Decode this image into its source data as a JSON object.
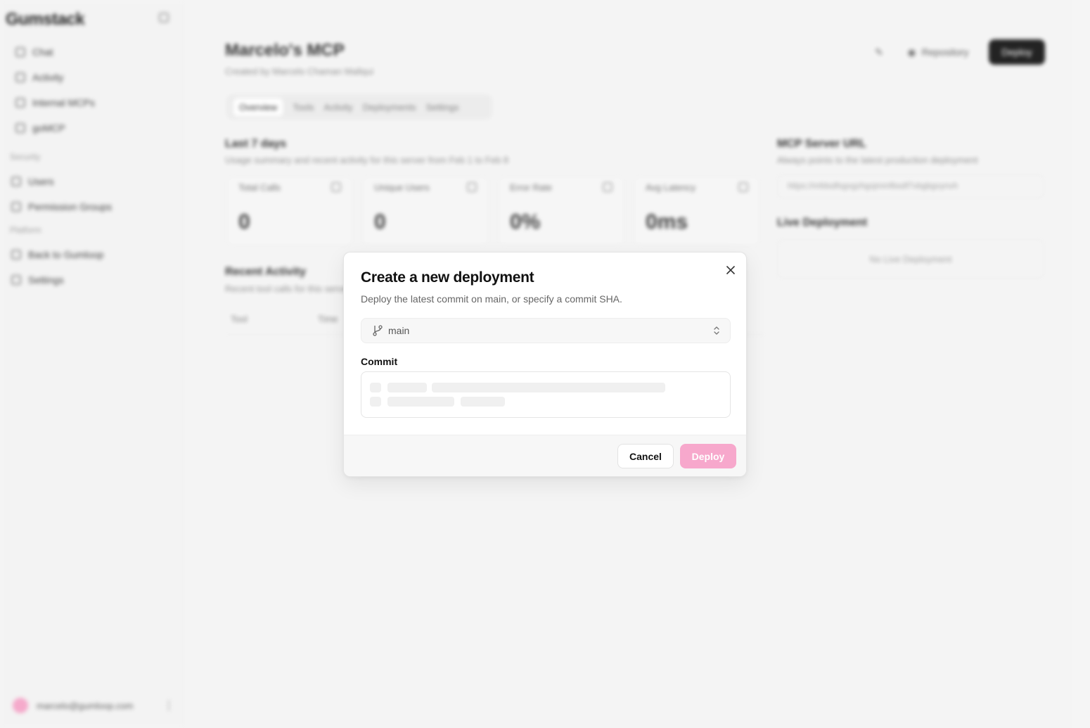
{
  "sidebar": {
    "logo": "Gumstack",
    "nav_items": [
      {
        "label": "Chat"
      },
      {
        "label": "Activity"
      },
      {
        "label": "Internal MCPs"
      },
      {
        "label": "goMCP"
      }
    ],
    "security_header": "Security",
    "security_items": [
      {
        "label": "Users"
      },
      {
        "label": "Permission Groups"
      }
    ],
    "platform_header": "Platform",
    "platform_items": [
      {
        "label": "Back to Gumloop"
      },
      {
        "label": "Settings"
      }
    ],
    "user_email": "marcelo@gumloop.com"
  },
  "header": {
    "title": "Marcelo's MCP",
    "subtitle": "Created by Marcelo Chaman Mallqui",
    "repo_label": "Repository",
    "deploy_label": "Deploy"
  },
  "tabs": [
    {
      "label": "Overview",
      "active": true
    },
    {
      "label": "Tools"
    },
    {
      "label": "Activity"
    },
    {
      "label": "Deployments"
    },
    {
      "label": "Settings"
    }
  ],
  "stats_section": {
    "title": "Last 7 days",
    "desc": "Usage summary and recent activity for this server from Feb 1 to Feb 8",
    "cards": [
      {
        "label": "Total Calls",
        "value": "0"
      },
      {
        "label": "Unique Users",
        "value": "0"
      },
      {
        "label": "Error Rate",
        "value": "0%"
      },
      {
        "label": "Avg Latency",
        "value": "0ms"
      }
    ]
  },
  "url_section": {
    "title": "MCP Server URL",
    "desc": "Always points to the latest production deployment",
    "url": "https://mfdsdfsgvgzhgsjmmfbsdf7vbgbgvynvh"
  },
  "live_section": {
    "title": "Live Deployment",
    "empty": "No Live Deployment"
  },
  "recent_section": {
    "title": "Recent Activity",
    "desc": "Recent tool calls for this server",
    "columns": [
      "Tool",
      "Time"
    ]
  },
  "modal": {
    "title": "Create a new deployment",
    "description": "Deploy the latest commit on main, or specify a commit SHA.",
    "branch": "main",
    "commit_label": "Commit",
    "cancel_label": "Cancel",
    "deploy_label": "Deploy"
  },
  "colors": {
    "accent_disabled": "#f7a8cc",
    "primary_dark": "#111111"
  },
  "icons": {
    "close": "close-icon",
    "branch": "git-branch-icon",
    "select": "chevron-up-down-icon"
  }
}
